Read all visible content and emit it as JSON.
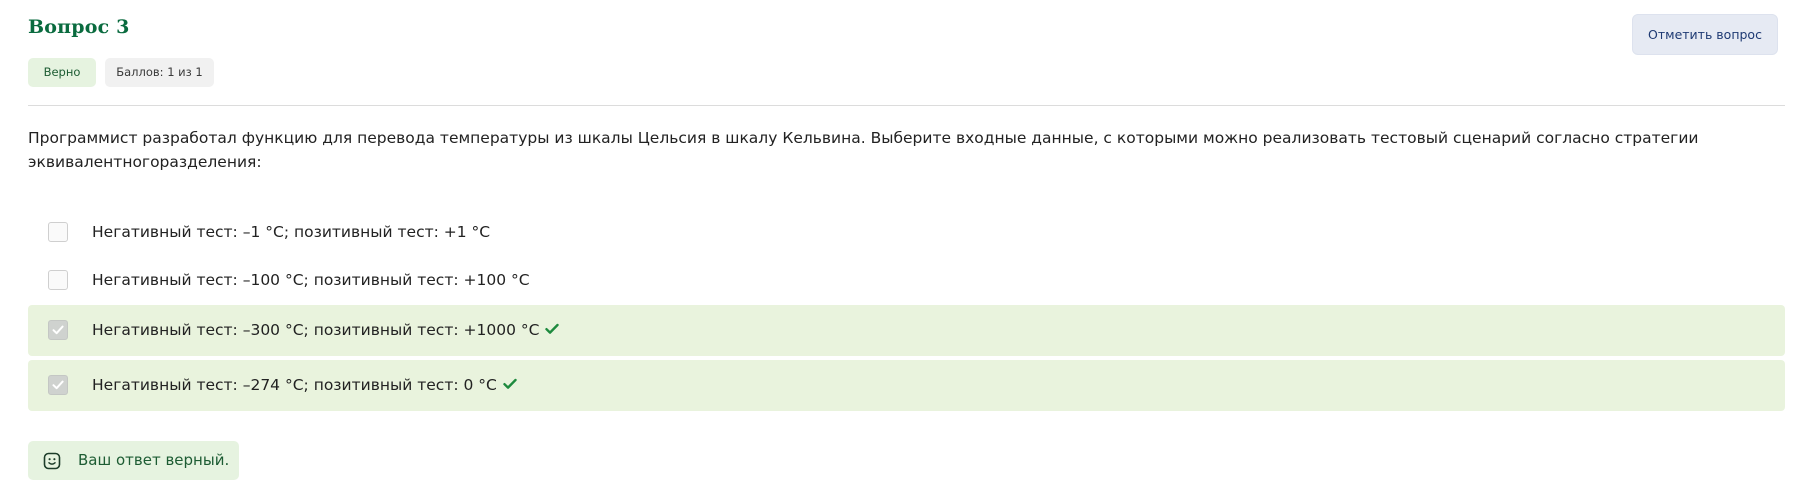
{
  "question": {
    "title": "Вопрос 3",
    "status_label": "Верно",
    "score_label": "Баллов: 1 из 1",
    "flag_button_label": "Отметить вопрос",
    "text": "Программист разработал функцию для перевода температуры из шкалы Цельсия в шкалу Кельвина. Выберите входные данные, с которыми можно реализовать тестовый сценарий согласно стратегии эквивалентногоразделения:"
  },
  "options": [
    {
      "label": "Негативный тест: –1 °C; позитивный тест: +1 °C",
      "checked": false,
      "correct": false
    },
    {
      "label": "Негативный тест: –100 °C; позитивный тест: +100 °C",
      "checked": false,
      "correct": false
    },
    {
      "label": "Негативный тест: –300 °C; позитивный тест: +1000 °C",
      "checked": true,
      "correct": true
    },
    {
      "label": "Негативный тест: –274 °C; позитивный тест: 0 °C",
      "checked": true,
      "correct": true
    }
  ],
  "feedback": {
    "text": "Ваш ответ верный.",
    "icon": "smile-icon"
  },
  "colors": {
    "title": "#0a6b3f",
    "correct_bg": "#e9f3dd",
    "tick": "#1e8a3e",
    "flag_button_bg": "#e6eaf3"
  }
}
